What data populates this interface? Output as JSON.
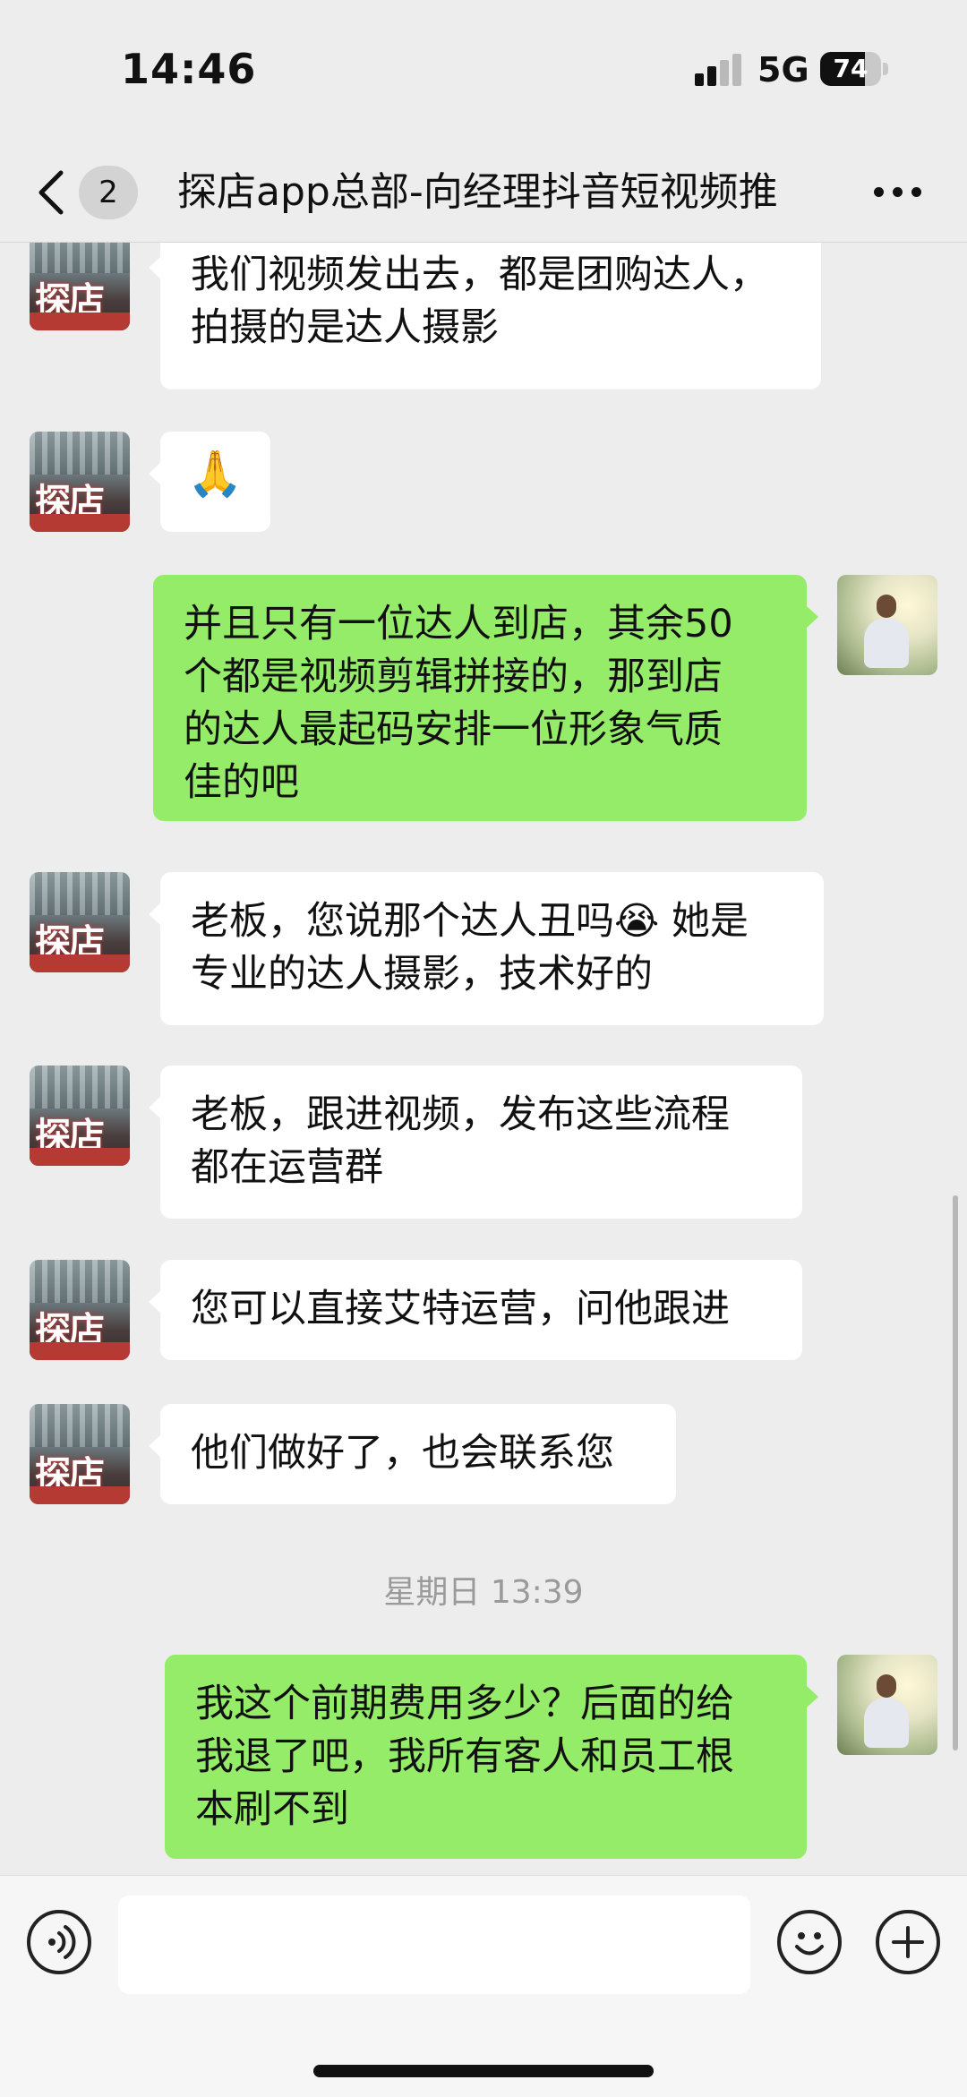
{
  "status_bar": {
    "time": "14:46",
    "network": "5G",
    "battery": "74",
    "battery_level": 0.74
  },
  "header": {
    "unread_badge": "2",
    "title": "探店app总部-向经理抖音短视频推",
    "back_icon": "chevron-left-icon",
    "more_icon": "ellipsis-icon"
  },
  "messages": [
    {
      "side": "left",
      "text": "我们视频发出去，都是团购达人，\n拍摄的是达人摄影"
    },
    {
      "side": "left",
      "text": "🙏"
    },
    {
      "side": "right",
      "text": "并且只有一位达人到店，其余50\n个都是视频剪辑拼接的，那到店\n的达人最起码安排一位形象气质\n佳的吧"
    },
    {
      "side": "left",
      "text": "老板，您说那个达人丑吗😭 她是\n专业的达人摄影，技术好的"
    },
    {
      "side": "left",
      "text": "老板，跟进视频，发布这些流程\n都在运营群"
    },
    {
      "side": "left",
      "text": "您可以直接艾特运营，问他跟进"
    },
    {
      "side": "left",
      "text": "他们做好了，也会联系您"
    },
    {
      "side": "right",
      "text": "我这个前期费用多少？后面的给\n我退了吧，我所有客人和员工根\n本刷不到"
    }
  ],
  "timestamp": "星期日 13:39",
  "input_bar": {
    "voice_icon": "voice-icon",
    "emoji_icon": "smiley-icon",
    "plus_icon": "plus-icon",
    "message_value": ""
  },
  "colors": {
    "background": "#ededed",
    "bubble_self": "#95ec69",
    "bubble_other": "#ffffff"
  }
}
